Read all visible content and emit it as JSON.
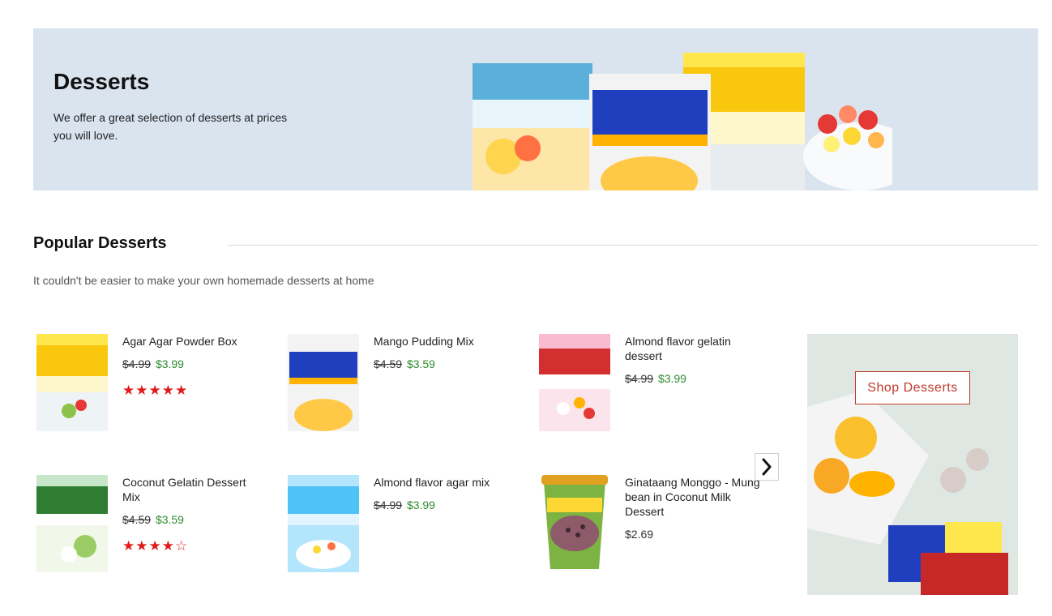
{
  "banner": {
    "title": "Desserts",
    "text": "We offer a great selection of desserts at prices you will love."
  },
  "section": {
    "title": "Popular Desserts",
    "subtitle": "It couldn't be easier to make your own homemade desserts at home"
  },
  "products": [
    {
      "name": "Agar Agar Powder Box",
      "old_price": "$4.99",
      "price": "$3.99",
      "rating_stars": "★★★★★",
      "rating": 5
    },
    {
      "name": "Mango Pudding Mix",
      "old_price": "$4.59",
      "price": "$3.59"
    },
    {
      "name": "Almond flavor gelatin dessert",
      "old_price": "$4.99",
      "price": "$3.99"
    },
    {
      "name": "Coconut Gelatin Dessert Mix",
      "old_price": "$4.59",
      "price": "$3.59",
      "rating_stars": "★★★★☆",
      "rating": 4
    },
    {
      "name": "Almond flavor agar mix",
      "old_price": "$4.99",
      "price": "$3.99"
    },
    {
      "name": "Ginataang Monggo - Mung bean in Coconut Milk Dessert",
      "price": "$2.69"
    }
  ],
  "promo": {
    "button_label": "Shop Desserts"
  },
  "colors": {
    "banner_bg": "#d9e4ef",
    "sale_price": "#2e8b2e",
    "stars": "#e21a1a",
    "accent": "#c0392b",
    "promo_bg": "#dfe7e3"
  },
  "icons": {
    "next": "chevron-right-icon"
  }
}
